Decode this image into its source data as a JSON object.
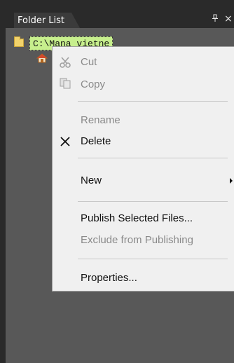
{
  "panel": {
    "title": "Folder List",
    "pin_glyph": "❙",
    "close_glyph": "×"
  },
  "tree": {
    "site_label": "C:\\Mana  vietne",
    "folder_icon": "folder-icon",
    "home_icon": "home-icon"
  },
  "context_menu": {
    "items": [
      {
        "label": "Cut",
        "enabled": false,
        "icon": "scissors-icon"
      },
      {
        "label": "Copy",
        "enabled": false,
        "icon": "copy-icon"
      },
      {
        "label": "Rename",
        "enabled": false
      },
      {
        "label": "Delete",
        "enabled": true,
        "icon": "delete-x-icon"
      },
      {
        "label": "New",
        "enabled": true,
        "has_submenu": true
      },
      {
        "label": "Publish Selected Files...",
        "enabled": true
      },
      {
        "label": "Exclude from Publishing",
        "enabled": false
      },
      {
        "label": "Properties...",
        "enabled": true
      }
    ]
  }
}
